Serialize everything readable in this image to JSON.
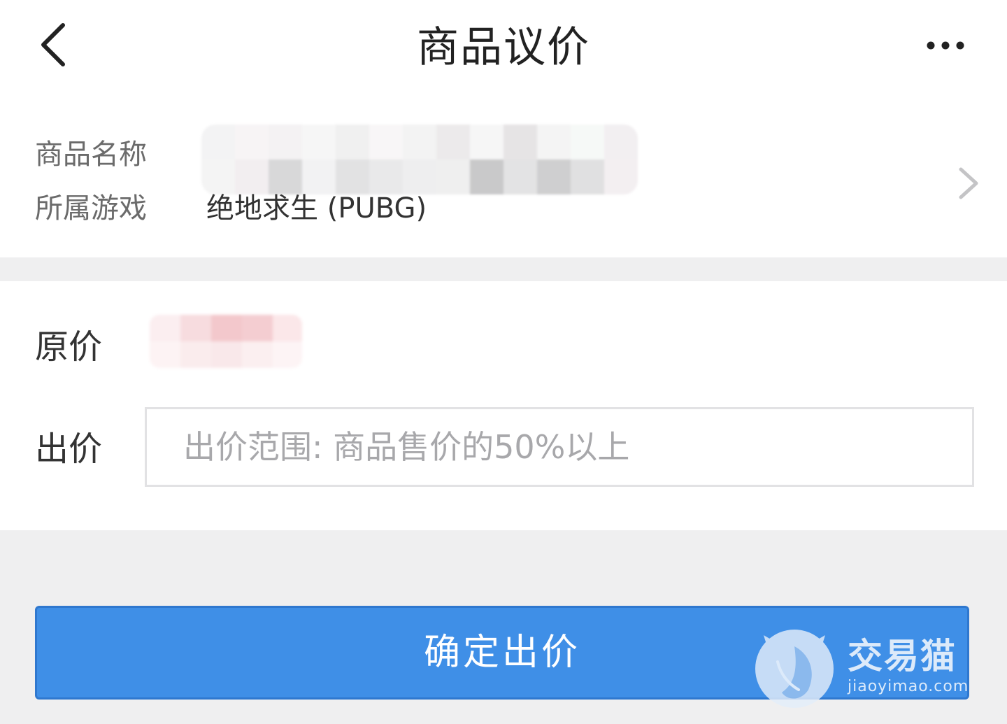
{
  "header": {
    "title": "商品议价",
    "back_icon": "chevron-left-icon",
    "more_icon": "more-horizontal-icon"
  },
  "product": {
    "name_label": "商品名称",
    "name_value_redacted": true,
    "game_label": "所属游戏",
    "game_value": "绝地求生 (PUBG)",
    "chevron_icon": "chevron-right-icon"
  },
  "pricing": {
    "original_label": "原价",
    "original_value_redacted": true,
    "bid_label": "出价",
    "bid_value": "",
    "bid_placeholder": "出价范围: 商品售价的50%以上"
  },
  "actions": {
    "confirm_label": "确定出价"
  },
  "watermark": {
    "name": "交易猫",
    "url": "jiaoyimao.com"
  },
  "colors": {
    "accent": "#3f8fe7",
    "accent_border": "#2f78cf",
    "background": "#efeff0",
    "surface": "#ffffff",
    "text_primary": "#222222",
    "text_secondary": "#6b6b6b",
    "placeholder": "#a8a8ab"
  }
}
